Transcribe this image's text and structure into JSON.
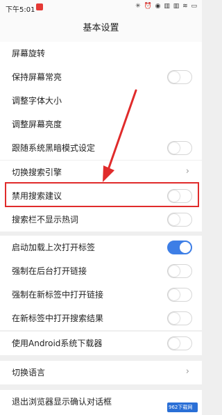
{
  "status_bar": {
    "time": "下午5:01",
    "icons": "✳ ⏰ ◉ ▥ ▥ ≋ ▭"
  },
  "header": {
    "title": "基本设置"
  },
  "section1": {
    "rows": [
      {
        "label": "屏幕旋转"
      },
      {
        "label": "保持屏幕常亮",
        "toggle": false
      },
      {
        "label": "调整字体大小"
      },
      {
        "label": "调整屏幕亮度"
      },
      {
        "label": "跟随系统黑暗模式设定",
        "toggle": false
      }
    ]
  },
  "section2": {
    "rows": [
      {
        "label": "切换搜索引擎",
        "chevron": "›"
      },
      {
        "label": "禁用搜索建议",
        "toggle": false
      },
      {
        "label": "搜索栏不显示热词",
        "toggle": false
      }
    ]
  },
  "section3": {
    "rows": [
      {
        "label": "启动加载上次打开标签",
        "toggle": true
      },
      {
        "label": "强制在后台打开链接",
        "toggle": false
      },
      {
        "label": "强制在新标签中打开链接",
        "toggle": false
      },
      {
        "label": "在新标签中打开搜索结果",
        "toggle": false
      }
    ]
  },
  "section4": {
    "rows": [
      {
        "label": "使用Android系统下载器",
        "toggle": false
      }
    ]
  },
  "section5": {
    "rows": [
      {
        "label": "切换语言",
        "chevron": "›"
      }
    ]
  },
  "section6": {
    "rows": [
      {
        "label": "退出浏览器显示确认对话框"
      }
    ]
  },
  "watermark": {
    "text": "962下载网"
  },
  "colors": {
    "accent": "#3d7ee6",
    "highlight": "#e02b2b"
  }
}
